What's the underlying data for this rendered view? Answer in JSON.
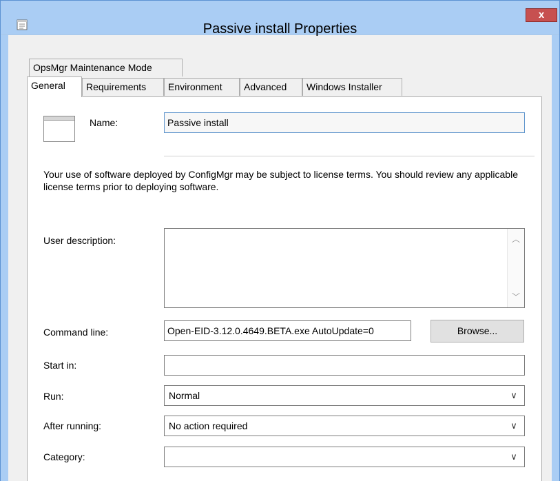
{
  "window": {
    "title": "Passive install Properties",
    "close_label": "x"
  },
  "tabs": {
    "row1": [
      {
        "label": "OpsMgr Maintenance Mode"
      }
    ],
    "row2": [
      {
        "label": "General",
        "selected": true
      },
      {
        "label": "Requirements"
      },
      {
        "label": "Environment"
      },
      {
        "label": "Advanced"
      },
      {
        "label": "Windows Installer"
      }
    ]
  },
  "general": {
    "name_label": "Name:",
    "name_value": "Passive install",
    "license_notice": "Your use of software deployed by ConfigMgr may be subject to license terms. You should review any applicable license terms prior to deploying software.",
    "user_description_label": "User description:",
    "user_description_value": "",
    "command_line_label": "Command line:",
    "command_line_value": "Open-EID-3.12.0.4649.BETA.exe AutoUpdate=0",
    "browse_label": "Browse...",
    "start_in_label": "Start in:",
    "start_in_value": "",
    "run_label": "Run:",
    "run_value": "Normal",
    "after_running_label": "After running:",
    "after_running_value": "No action required",
    "category_label": "Category:",
    "category_value": ""
  },
  "icons": {
    "app": "properties-window-icon",
    "program": "program-window-icon",
    "chevron": "chevron-down-icon"
  },
  "colors": {
    "titlebar": "#aacdf4",
    "close_button": "#c75050",
    "panel_bg": "#ffffff",
    "dialog_bg": "#f0f0f0"
  }
}
